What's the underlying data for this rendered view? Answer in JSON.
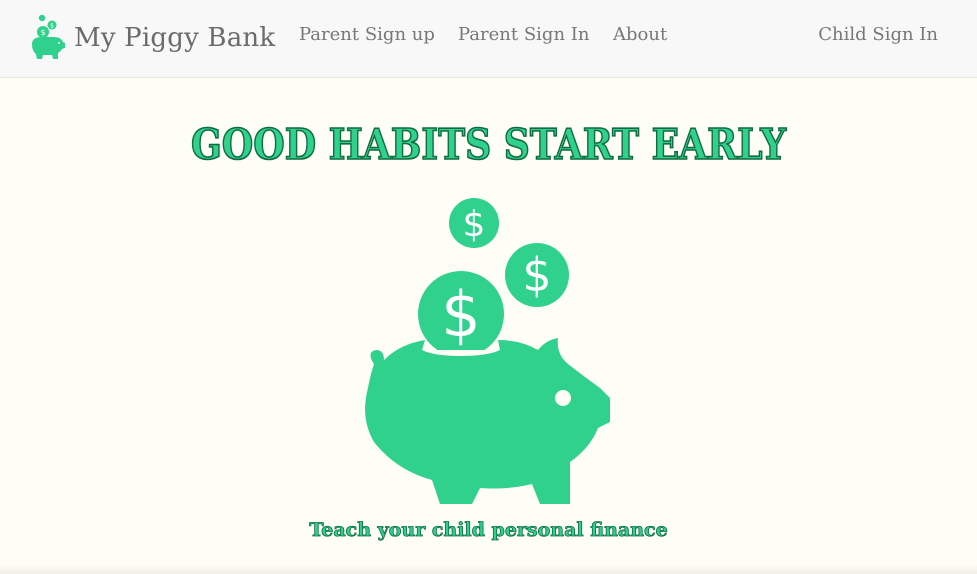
{
  "navbar": {
    "brand": "My Piggy Bank",
    "links": [
      "Parent Sign up",
      "Parent Sign In",
      "About"
    ],
    "right_link": "Child Sign In"
  },
  "hero": {
    "title": "GOOD HABITS START EARLY",
    "tagline": "Teach your child personal finance",
    "coin_symbol": "$"
  },
  "colors": {
    "accent": "#2fd18c",
    "accent_outline": "#0f6b40",
    "nav_bg": "#f8f8f8",
    "nav_text": "#777777",
    "page_bg": "#fefef6"
  },
  "icons": {
    "brand": "piggy-bank-logo-icon",
    "hero": "piggy-bank-with-coins-illustration"
  }
}
